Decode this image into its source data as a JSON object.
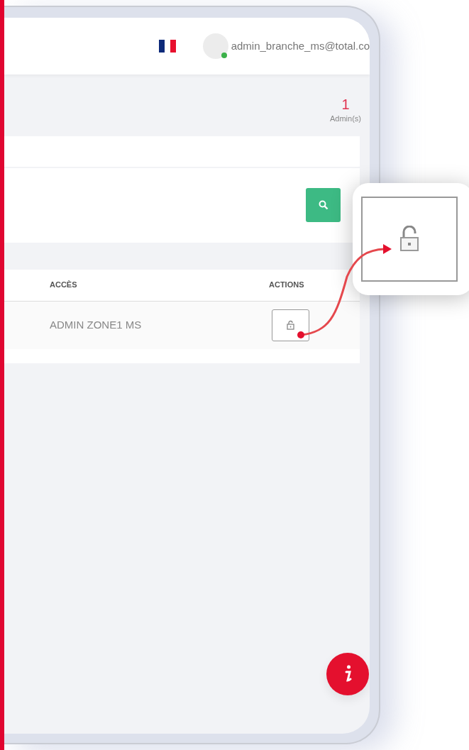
{
  "header": {
    "user_email": "admin_branche_ms@total.co",
    "online": true
  },
  "stats": {
    "count": "1",
    "label": "Admin(s)"
  },
  "table": {
    "columns": [
      "ACCÈS",
      "ACTIONS"
    ],
    "rows": [
      {
        "access": "ADMIN ZONE1 MS"
      }
    ]
  }
}
